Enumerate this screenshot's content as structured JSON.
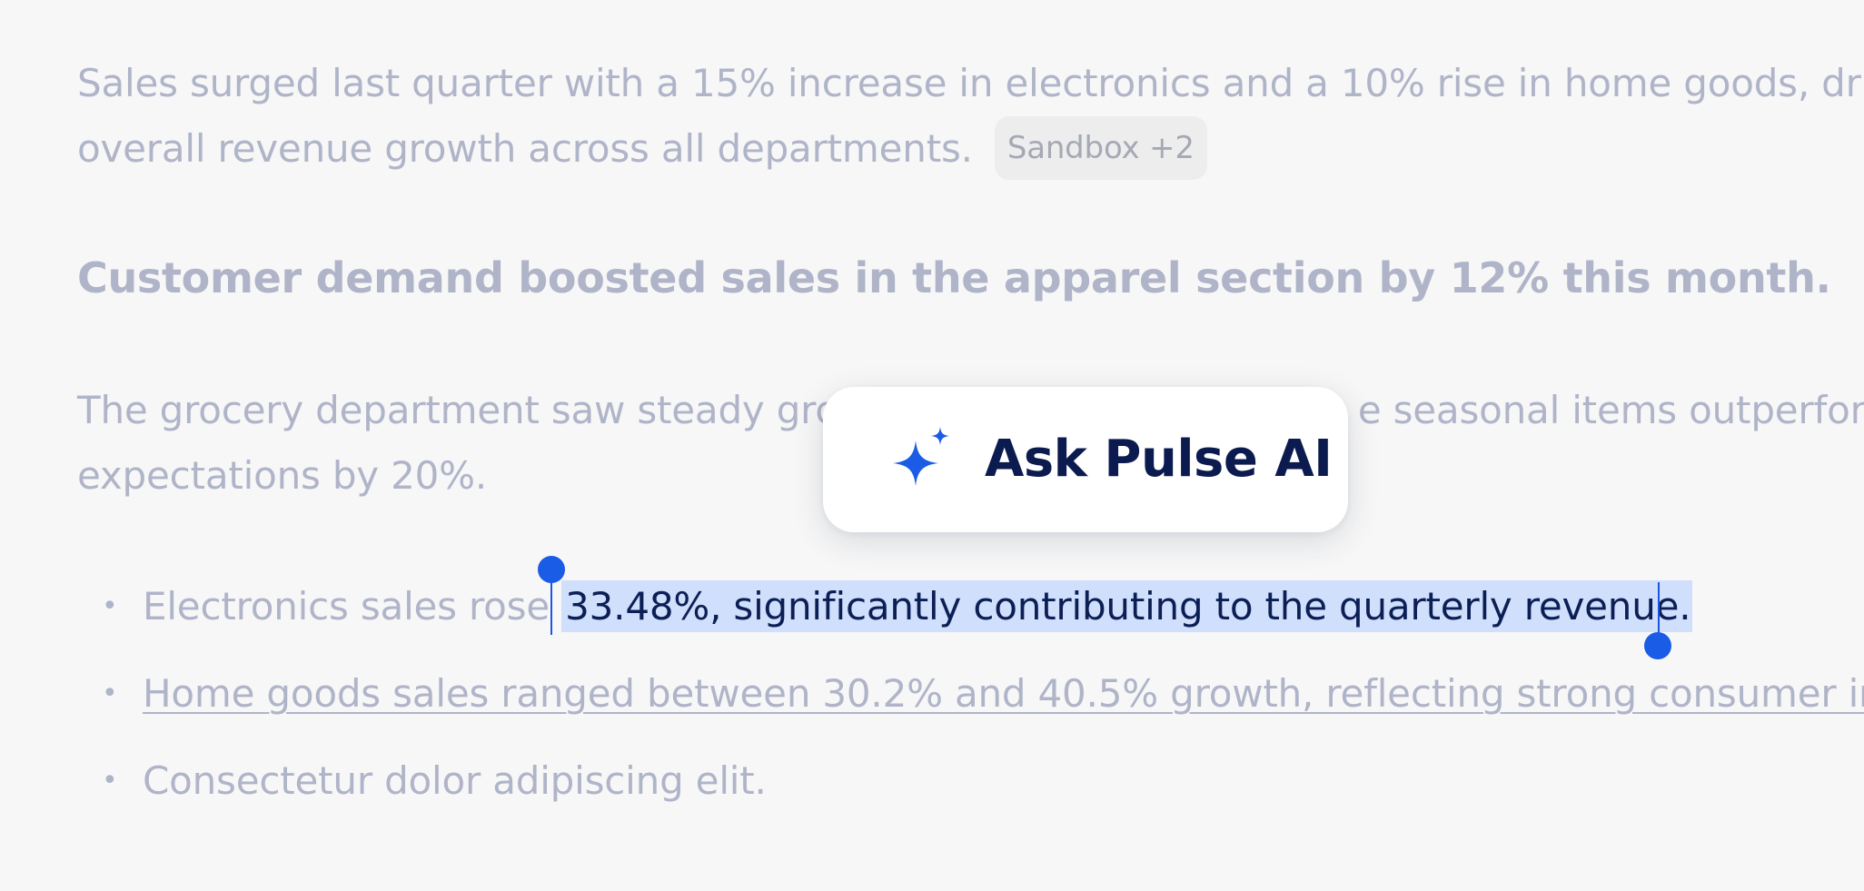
{
  "document": {
    "paragraph1": {
      "line1": "Sales surged last quarter with a 15% increase in electronics and a 10% rise in home goods, driving",
      "line2": "overall revenue growth across all departments.",
      "chip": "Sandbox +2"
    },
    "heading": "Customer demand boosted sales in the apparel section by 12% this month.",
    "paragraph2": {
      "line1_left": "The grocery department saw steady gro",
      "line1_right": "e seasonal items outperform",
      "line2": "expectations by 20%."
    },
    "list": [
      {
        "bullet": "•",
        "text_before_selection": "Electronics sales rose ",
        "selected_text": "33.48%, significantly contributing to the quarterly revenue."
      },
      {
        "bullet": "•",
        "text": "Home goods sales ranged between 30.2% and 40.5% growth, reflecting strong consumer int"
      },
      {
        "bullet": "•",
        "text": "Consectetur dolor adipiscing elit."
      }
    ]
  },
  "popup": {
    "label": "Ask Pulse AI",
    "icon": "sparkle-icon"
  },
  "colors": {
    "background": "#f7f7f7",
    "muted_text": "#afb4c8",
    "selection_background": "#cfdffc",
    "selection_text": "#0c1f55",
    "accent": "#1a5ce6",
    "popup_text": "#0c1b4f"
  }
}
